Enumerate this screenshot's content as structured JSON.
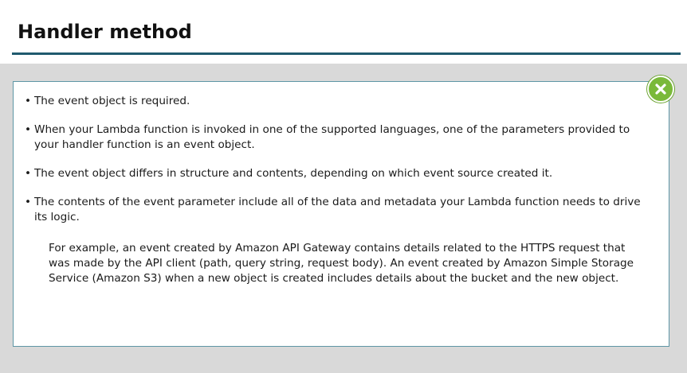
{
  "header": {
    "title": "Handler method"
  },
  "close_button": {
    "icon": "close-icon",
    "color": "#7ab93a"
  },
  "content": {
    "bullets": [
      "The event object is required.",
      "When your Lambda function is invoked in one of the supported languages, one of the parameters provided to your handler function is an event object.",
      "The event object differs in structure and contents, depending on which event source created it.",
      "The contents of the event parameter include all of the data and metadata your Lambda function needs to drive its logic."
    ],
    "example": "For example, an event created by Amazon API Gateway contains details related to the HTTPS request that was made by the API client (path, query string, request body). An event created by Amazon Simple Storage Service (Amazon S3) when a new object is created includes details about the bucket and the new object."
  },
  "colors": {
    "title_rule": "#1f5a6e",
    "panel_border": "#5e96a6",
    "background": "#d9d9d9"
  }
}
